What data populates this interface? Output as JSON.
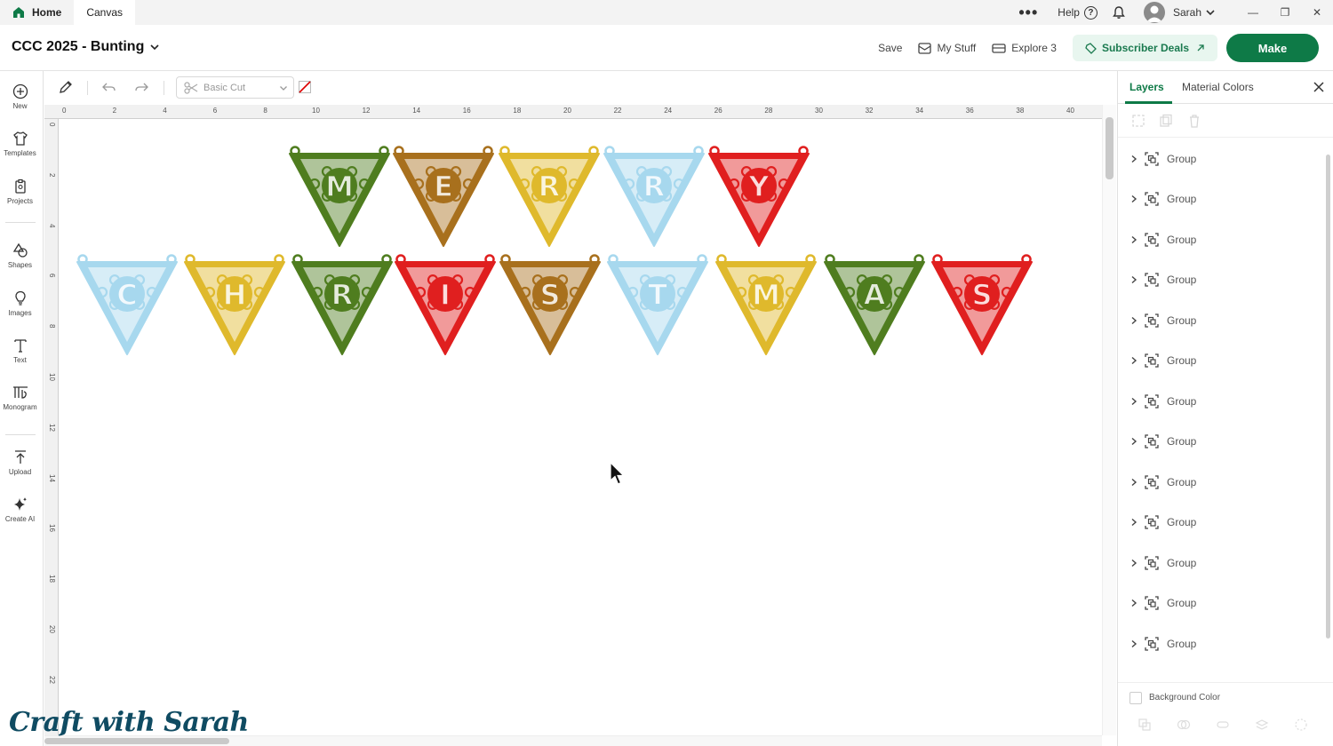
{
  "titlebar": {
    "tabs": [
      {
        "label": "Home",
        "active": false
      },
      {
        "label": "Canvas",
        "active": true
      }
    ],
    "more_icon": "more-horizontal-icon",
    "help_label": "Help",
    "user_name": "Sarah"
  },
  "header": {
    "project_title": "CCC 2025 - Bunting",
    "save_label": "Save",
    "my_stuff_label": "My Stuff",
    "machine_label": "Explore 3",
    "deals_label": "Subscriber Deals",
    "make_label": "Make"
  },
  "left_tools": [
    {
      "label": "New",
      "icon": "plus-circle-icon"
    },
    {
      "label": "Templates",
      "icon": "tshirt-icon"
    },
    {
      "label": "Projects",
      "icon": "clipboard-icon"
    },
    {
      "label": "Shapes",
      "icon": "shapes-icon"
    },
    {
      "label": "Images",
      "icon": "bulb-icon"
    },
    {
      "label": "Text",
      "icon": "text-icon"
    },
    {
      "label": "Monogram",
      "icon": "monogram-icon"
    },
    {
      "label": "Upload",
      "icon": "upload-icon"
    },
    {
      "label": "Create AI",
      "icon": "sparkle-icon"
    }
  ],
  "canvas_toolbar": {
    "operation_label": "Basic Cut"
  },
  "rulers": {
    "horizontal": [
      "0",
      "2",
      "4",
      "6",
      "8",
      "10",
      "12",
      "14",
      "16",
      "18",
      "20",
      "22",
      "24",
      "26",
      "28",
      "30",
      "32",
      "34",
      "36",
      "38",
      "40"
    ],
    "vertical": [
      "0",
      "2",
      "4",
      "6",
      "8",
      "10",
      "12",
      "14",
      "16",
      "18",
      "20",
      "22"
    ]
  },
  "bunting": {
    "row1": [
      {
        "letter": "M",
        "color": "#4f7d1f"
      },
      {
        "letter": "E",
        "color": "#a8701d"
      },
      {
        "letter": "R",
        "color": "#dfb92c"
      },
      {
        "letter": "R",
        "color": "#a7d8ee"
      },
      {
        "letter": "Y",
        "color": "#e01f1f"
      }
    ],
    "row2": [
      {
        "letter": "C",
        "color": "#a7d8ee"
      },
      {
        "letter": "H",
        "color": "#dfb92c"
      },
      {
        "letter": "R",
        "color": "#4f7d1f"
      },
      {
        "letter": "I",
        "color": "#e01f1f"
      },
      {
        "letter": "S",
        "color": "#a8701d"
      },
      {
        "letter": "T",
        "color": "#a7d8ee"
      },
      {
        "letter": "M",
        "color": "#dfb92c"
      },
      {
        "letter": "A",
        "color": "#4f7d1f"
      },
      {
        "letter": "S",
        "color": "#e01f1f"
      }
    ]
  },
  "right_panel": {
    "tabs": [
      {
        "label": "Layers",
        "active": true
      },
      {
        "label": "Material Colors",
        "active": false
      }
    ],
    "layers": [
      "Group",
      "Group",
      "Group",
      "Group",
      "Group",
      "Group",
      "Group",
      "Group",
      "Group",
      "Group",
      "Group",
      "Group",
      "Group"
    ],
    "background_color_label": "Background Color"
  },
  "watermark": "Craft with Sarah",
  "colors": {
    "brand_green": "#0e7a47",
    "deals_bg": "#e8f6ef"
  }
}
